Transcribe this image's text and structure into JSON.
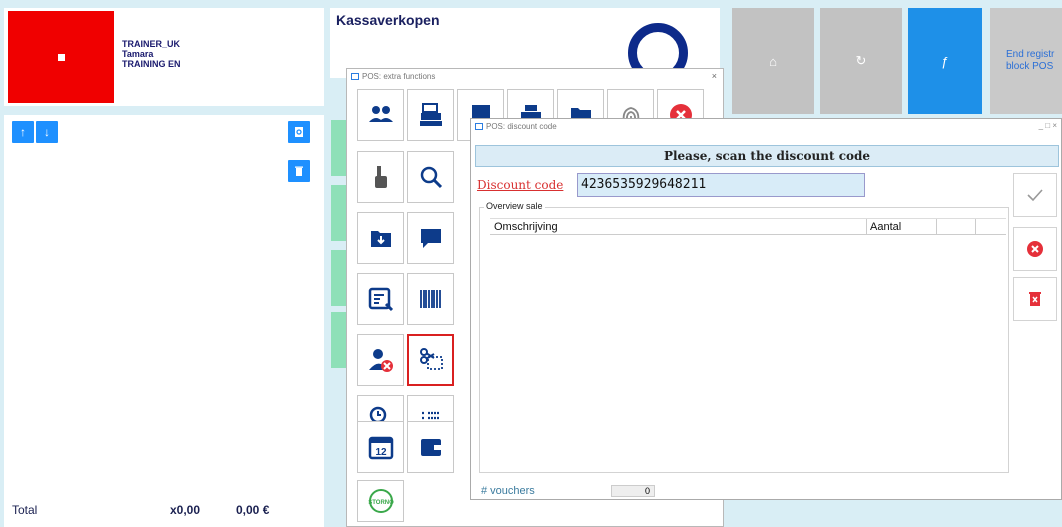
{
  "user": {
    "trainer": "TRAINER_UK",
    "name": "Tamara",
    "mode": "TRAINING EN"
  },
  "header": {
    "title": "Kassaverkopen"
  },
  "tiles": {
    "home_glyph": "⌂",
    "refresh_glyph": "↻",
    "f_glyph": "ƒ",
    "end_registration_line1": "End registr",
    "end_registration_line2": "block POS"
  },
  "totals": {
    "label": "Total",
    "count": "x0,00",
    "amount": "0,00 €"
  },
  "extra_functions": {
    "title": "POS: extra functions",
    "close": "×",
    "storno_label": "STORNO"
  },
  "discount": {
    "title": "POS: discount code",
    "window_controls": "_ □ ×",
    "instruction": "Please, scan the discount code",
    "field_label": "Discount code",
    "field_value": "4236535929648211",
    "overview_label": "Overview sale",
    "columns": [
      "Omschrijving",
      "Aantal"
    ],
    "vouchers_label": "# vouchers",
    "vouchers_value": "0"
  },
  "colors": {
    "stop": "#f00000",
    "accent_blue": "#1e90ff",
    "dark_blue": "#0d3b8a",
    "danger": "#e5303a"
  }
}
